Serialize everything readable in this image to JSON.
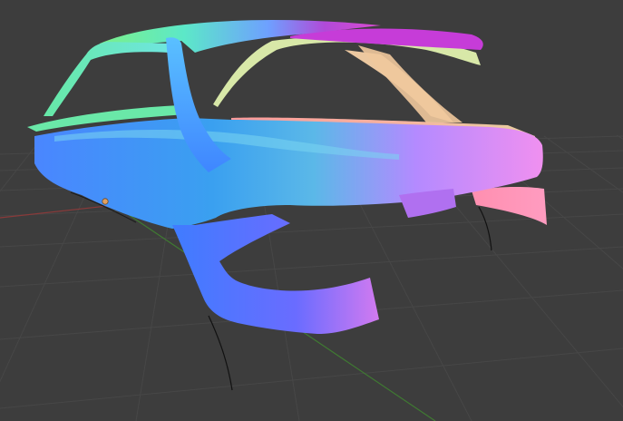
{
  "viewport": {
    "background_color": "#3d3d3d",
    "grid_color": "#474747",
    "x_axis_color": "#8a3a3a",
    "y_axis_color": "#3f7a32",
    "origin_marker_color": "#e0a060"
  },
  "scene": {
    "object_shading": "normal-map",
    "object_description_icon": "car-body-mesh",
    "curve_color": "#111111"
  }
}
